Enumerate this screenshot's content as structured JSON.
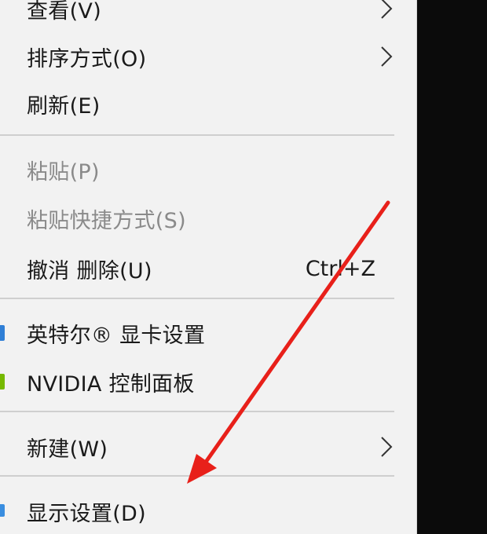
{
  "context_menu": {
    "items": [
      {
        "label": "查看(V)",
        "has_submenu": true,
        "disabled": false
      },
      {
        "label": "排序方式(O)",
        "has_submenu": true,
        "disabled": false
      },
      {
        "label": "刷新(E)",
        "has_submenu": false,
        "disabled": false
      },
      {
        "label": "粘贴(P)",
        "has_submenu": false,
        "disabled": true
      },
      {
        "label": "粘贴快捷方式(S)",
        "has_submenu": false,
        "disabled": true
      },
      {
        "label": "撤消 删除(U)",
        "shortcut": "Ctrl+Z",
        "has_submenu": false,
        "disabled": false
      },
      {
        "label": "英特尔® 显卡设置",
        "icon": "intel-graphics-icon",
        "has_submenu": false,
        "disabled": false
      },
      {
        "label": "NVIDIA 控制面板",
        "icon": "nvidia-icon",
        "has_submenu": false,
        "disabled": false
      },
      {
        "label": "新建(W)",
        "has_submenu": true,
        "disabled": false
      },
      {
        "label": "显示设置(D)",
        "icon": "display-settings-icon",
        "has_submenu": false,
        "disabled": false
      }
    ]
  },
  "colors": {
    "menu_bg": "#f2f2f2",
    "desktop_bg": "#0b0b0b",
    "annotation_arrow": "#e8201a",
    "intel_icon": "#2f7fd6",
    "nvidia_icon": "#76b900"
  }
}
